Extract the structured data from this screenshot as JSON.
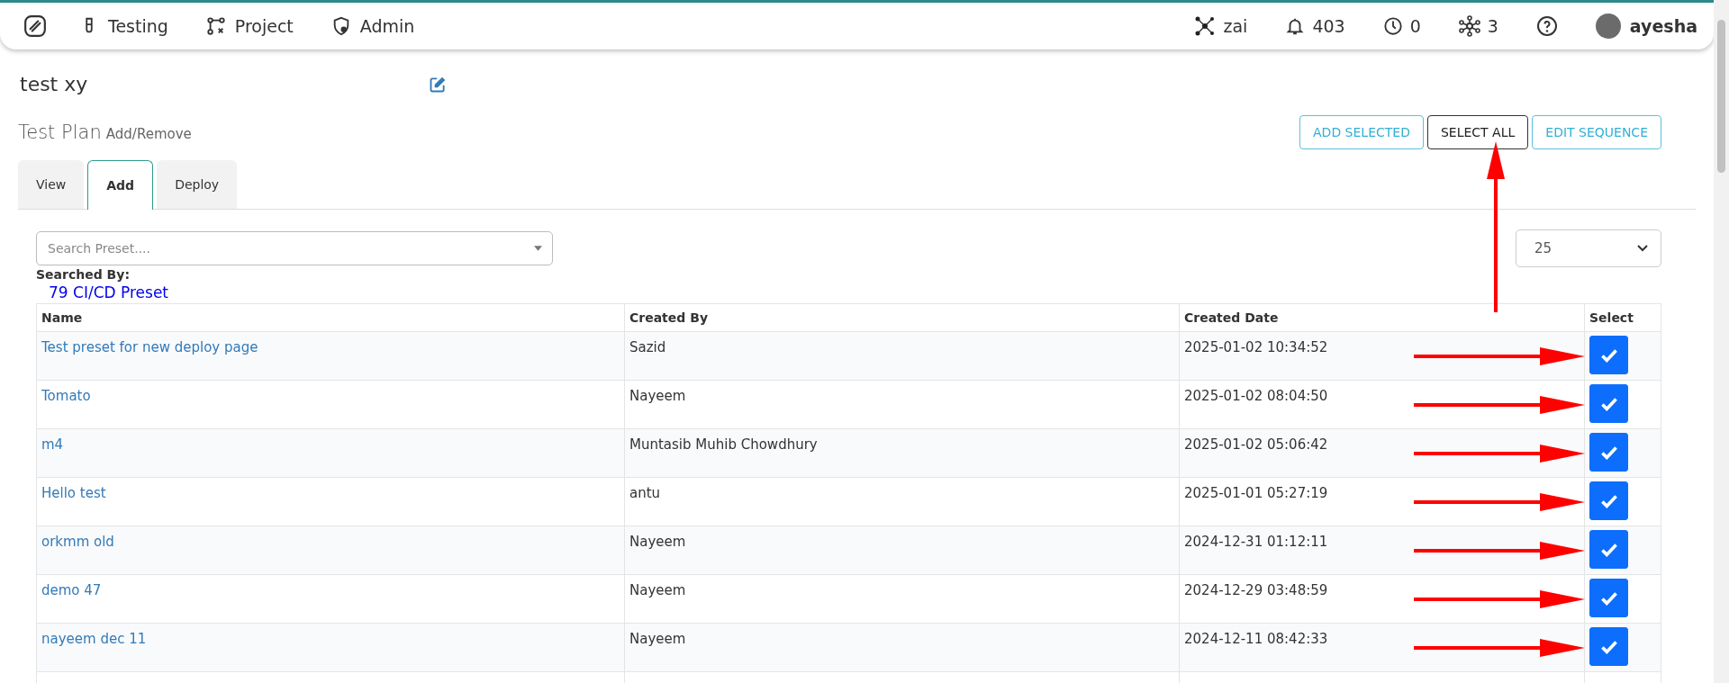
{
  "nav": {
    "items": [
      {
        "label": "Testing"
      },
      {
        "label": "Project"
      },
      {
        "label": "Admin"
      }
    ],
    "status": [
      {
        "label": "zai"
      },
      {
        "label": "403"
      },
      {
        "label": "0"
      },
      {
        "label": "3"
      }
    ],
    "user": "ayesha"
  },
  "page_title": "test xy",
  "section": {
    "title": "Test Plan",
    "subtitle": "Add/Remove"
  },
  "buttons": [
    {
      "label": "ADD SELECTED",
      "kind": "outline"
    },
    {
      "label": "SELECT ALL",
      "kind": "dark"
    },
    {
      "label": "EDIT SEQUENCE",
      "kind": "outline"
    }
  ],
  "tabs": [
    {
      "label": "View",
      "selected": false
    },
    {
      "label": "Add",
      "selected": true
    },
    {
      "label": "Deploy",
      "selected": false
    }
  ],
  "search": {
    "placeholder": "Search Preset...."
  },
  "page_size": "25",
  "searched_by": {
    "label": "Searched By:",
    "value": "79 CI/CD Preset"
  },
  "table": {
    "columns": [
      "Name",
      "Created By",
      "Created Date",
      "Select"
    ],
    "rows": [
      {
        "name": "Test preset for new deploy page",
        "created_by": "Sazid",
        "created_date": "2025-01-02 10:34:52",
        "checked": true
      },
      {
        "name": "Tomato",
        "created_by": "Nayeem",
        "created_date": "2025-01-02 08:04:50",
        "checked": true
      },
      {
        "name": "m4",
        "created_by": "Muntasib Muhib Chowdhury",
        "created_date": "2025-01-02 05:06:42",
        "checked": true
      },
      {
        "name": "Hello test",
        "created_by": "antu",
        "created_date": "2025-01-01 05:27:19",
        "checked": true
      },
      {
        "name": "orkmm old",
        "created_by": "Nayeem",
        "created_date": "2024-12-31 01:12:11",
        "checked": true
      },
      {
        "name": "demo 47",
        "created_by": "Nayeem",
        "created_date": "2024-12-29 03:48:59",
        "checked": true
      },
      {
        "name": "nayeem dec 11",
        "created_by": "Nayeem",
        "created_date": "2024-12-11 08:42:33",
        "checked": true
      }
    ]
  }
}
